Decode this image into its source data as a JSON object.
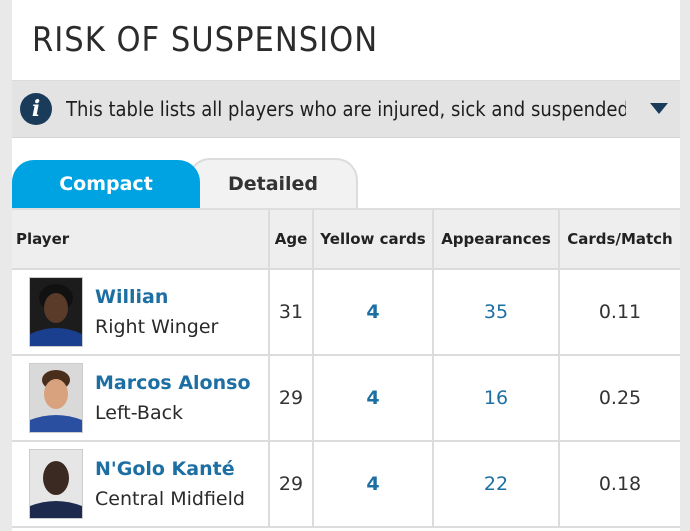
{
  "header": {
    "title": "RISK OF SUSPENSION"
  },
  "info": {
    "text": "This table lists all players who are injured, sick and suspended, an..."
  },
  "tabs": {
    "compact": "Compact",
    "detailed": "Detailed"
  },
  "table": {
    "columns": [
      "Player",
      "Age",
      "Yellow cards",
      "Appearances",
      "Cards/Match"
    ],
    "rows": [
      {
        "name": "Willian",
        "position": "Right Winger",
        "age": "31",
        "yellow_cards": "4",
        "appearances": "35",
        "cards_per_match": "0.11"
      },
      {
        "name": "Marcos Alonso",
        "position": "Left-Back",
        "age": "29",
        "yellow_cards": "4",
        "appearances": "16",
        "cards_per_match": "0.25"
      },
      {
        "name": "N'Golo Kanté",
        "position": "Central Midfield",
        "age": "29",
        "yellow_cards": "4",
        "appearances": "22",
        "cards_per_match": "0.18"
      }
    ]
  },
  "colors": {
    "accent": "#00a3e2",
    "link": "#1d6fa3",
    "icon_bg": "#1a3c5a"
  }
}
